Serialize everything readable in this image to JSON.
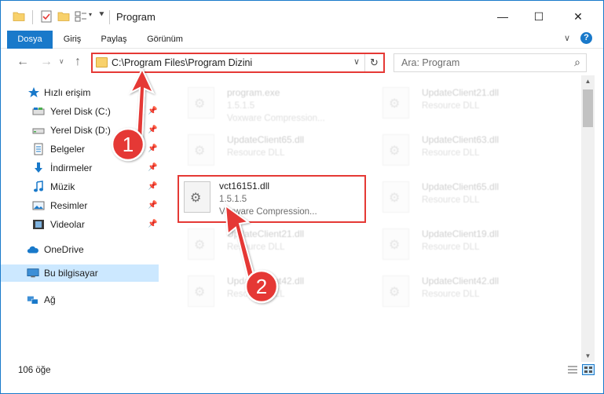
{
  "window": {
    "title": "Program",
    "controls": {
      "minimize": "—",
      "maximize": "☐",
      "close": "✕"
    }
  },
  "ribbon": {
    "tabs": [
      {
        "label": "Dosya",
        "active": true
      },
      {
        "label": "Giriş",
        "active": false
      },
      {
        "label": "Paylaş",
        "active": false
      },
      {
        "label": "Görünüm",
        "active": false
      }
    ],
    "collapse_glyph": "∨",
    "help_glyph": "?"
  },
  "navigation": {
    "back_glyph": "←",
    "forward_glyph": "→",
    "recent_glyph": "∨",
    "up_glyph": "↑",
    "address_path": "C:\\Program Files\\Program Dizini",
    "address_dropdown_glyph": "∨",
    "refresh_glyph": "↻",
    "search_placeholder": "Ara: Program",
    "search_glyph": "⌕"
  },
  "sidebar": {
    "items": [
      {
        "label": "Hızlı erişim",
        "icon": "star-icon",
        "pinned": false
      },
      {
        "label": "Yerel Disk (C:)",
        "icon": "drive-icon",
        "pinned": true
      },
      {
        "label": "Yerel Disk (D:)",
        "icon": "drive-icon",
        "pinned": true
      },
      {
        "label": "Belgeler",
        "icon": "documents-icon",
        "pinned": true
      },
      {
        "label": "İndirmeler",
        "icon": "download-icon",
        "pinned": true
      },
      {
        "label": "Müzik",
        "icon": "music-icon",
        "pinned": true
      },
      {
        "label": "Resimler",
        "icon": "pictures-icon",
        "pinned": true
      },
      {
        "label": "Videolar",
        "icon": "video-icon",
        "pinned": true
      },
      {
        "label": "OneDrive",
        "icon": "cloud-icon",
        "pinned": false
      },
      {
        "label": "Bu bilgisayar",
        "icon": "computer-icon",
        "pinned": false,
        "selected": true
      },
      {
        "label": "Ağ",
        "icon": "network-icon",
        "pinned": false
      }
    ],
    "pin_glyph": "📌"
  },
  "files": [
    {
      "name": "program.exe",
      "line2": "1.5.1.5",
      "line3": "Voxware Compression...",
      "dim": true
    },
    {
      "name": "UpdateClient21.dll",
      "line2": "Resource DLL",
      "line3": "",
      "dim": true
    },
    {
      "name": "UpdateClient65.dll",
      "line2": "Resource DLL",
      "line3": "",
      "dim": true
    },
    {
      "name": "UpdateClient63.dll",
      "line2": "Resource DLL",
      "line3": "",
      "dim": true
    },
    {
      "name": "vct16151.dll",
      "line2": "1.5.1.5",
      "line3": "Voxware Compression...",
      "dim": false,
      "highlight": true
    },
    {
      "name": "UpdateClient65.dll",
      "line2": "Resource DLL",
      "line3": "",
      "dim": true
    },
    {
      "name": "UpdateClient21.dll",
      "line2": "Resource DLL",
      "line3": "",
      "dim": true
    },
    {
      "name": "UpdateClient19.dll",
      "line2": "Resource DLL",
      "line3": "",
      "dim": true
    },
    {
      "name": "UpdateClient42.dll",
      "line2": "Resource DLL",
      "line3": "",
      "dim": true
    },
    {
      "name": "UpdateClient42.dll",
      "line2": "Resource DLL",
      "line3": "",
      "dim": true
    }
  ],
  "status": {
    "item_count": "106 öğe"
  },
  "annotations": {
    "step1": "1",
    "step2": "2",
    "accent_color": "#e53935"
  },
  "colors": {
    "accent": "#1979ca",
    "selection": "#cce8ff",
    "folder": "#f8d16b"
  }
}
